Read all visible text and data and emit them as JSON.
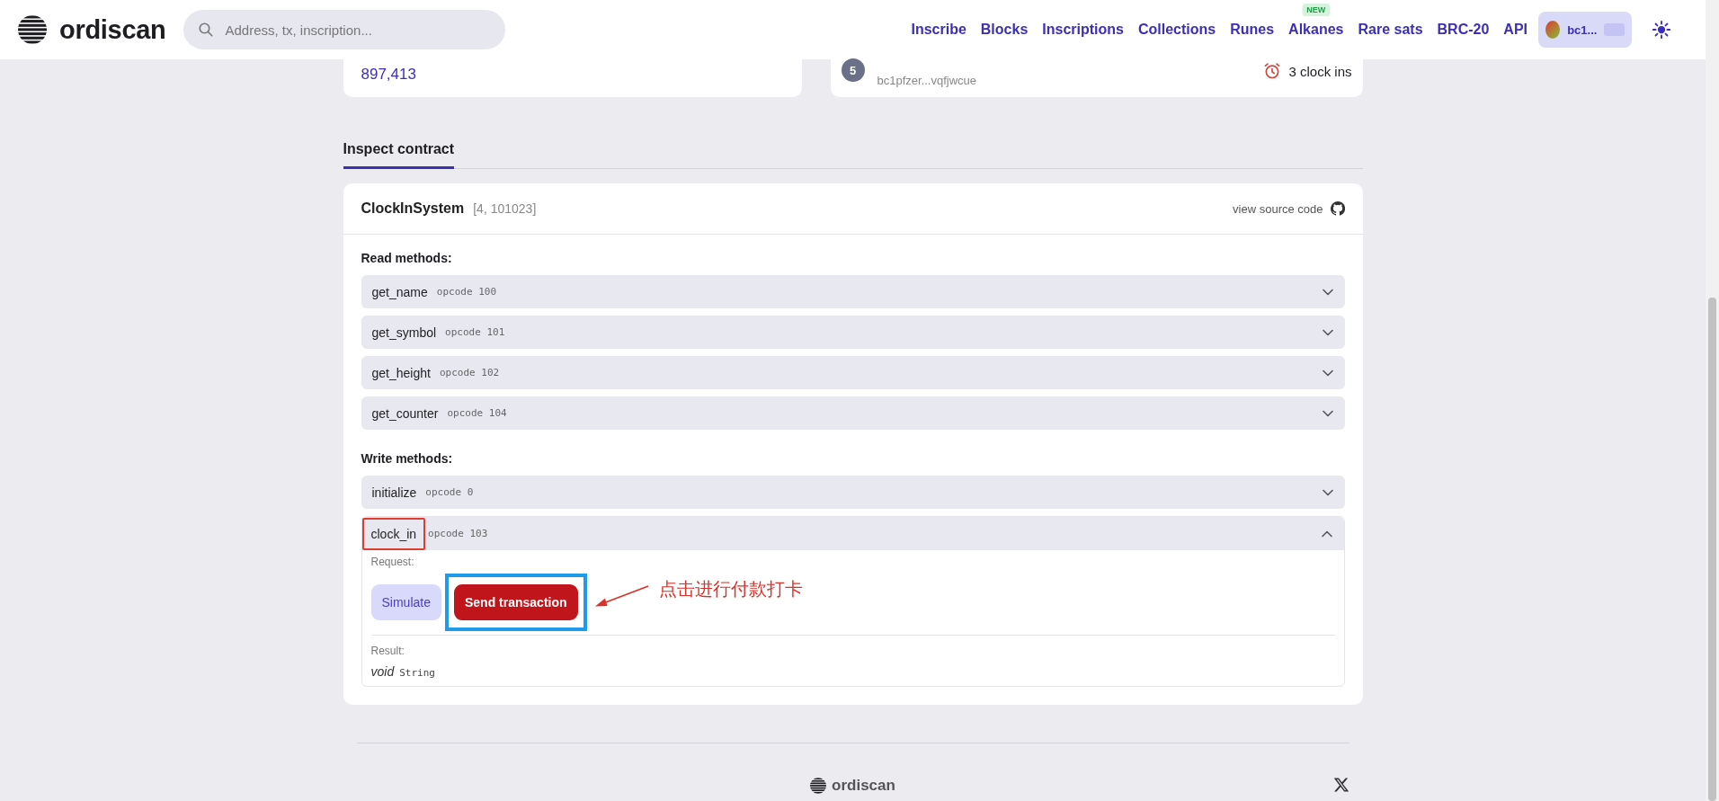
{
  "header": {
    "logo": "ordiscan",
    "search": {
      "placeholder": "Address, tx, inscription..."
    },
    "nav": [
      {
        "label": "Inscribe"
      },
      {
        "label": "Blocks"
      },
      {
        "label": "Inscriptions"
      },
      {
        "label": "Collections"
      },
      {
        "label": "Runes"
      },
      {
        "label": "Alkanes",
        "badge": "NEW"
      },
      {
        "label": "Rare sats"
      },
      {
        "label": "BRC-20"
      },
      {
        "label": "API"
      }
    ],
    "wallet": {
      "label": "bc1..."
    }
  },
  "summary_cards": [
    {
      "kind": "value",
      "value": "897,413"
    },
    {
      "kind": "leader",
      "rank": "5",
      "address": "bc1pfzer...vqfjwcue",
      "count": "3 clock ins"
    }
  ],
  "tabs": [
    {
      "label": "Inspect contract",
      "selected": true
    }
  ],
  "contract": {
    "name": "ClockInSystem",
    "id": "[4, 101023]",
    "source_link": "view source code",
    "sections": [
      {
        "title": "Read methods:",
        "methods": [
          {
            "name": "get_name",
            "opcode": "opcode 100",
            "expanded": false,
            "highlighted": false
          },
          {
            "name": "get_symbol",
            "opcode": "opcode 101",
            "expanded": false,
            "highlighted": false
          },
          {
            "name": "get_height",
            "opcode": "opcode 102",
            "expanded": false,
            "highlighted": false
          },
          {
            "name": "get_counter",
            "opcode": "opcode 104",
            "expanded": false,
            "highlighted": false
          }
        ]
      },
      {
        "title": "Write methods:",
        "methods": [
          {
            "name": "initialize",
            "opcode": "opcode 0",
            "expanded": false,
            "highlighted": false
          },
          {
            "name": "clock_in",
            "opcode": "opcode 103",
            "expanded": true,
            "highlighted": true,
            "request_label": "Request:",
            "buttons": [
              {
                "kind": "secondary",
                "label": "Simulate",
                "highlighted": false
              },
              {
                "kind": "primary",
                "label": "Send transaction",
                "highlighted": true
              }
            ],
            "callout": "点击进行付款打卡",
            "result_label": "Result:",
            "result_type": "void",
            "result_value": "String"
          }
        ]
      }
    ]
  },
  "footer": {
    "logo": "ordiscan"
  }
}
